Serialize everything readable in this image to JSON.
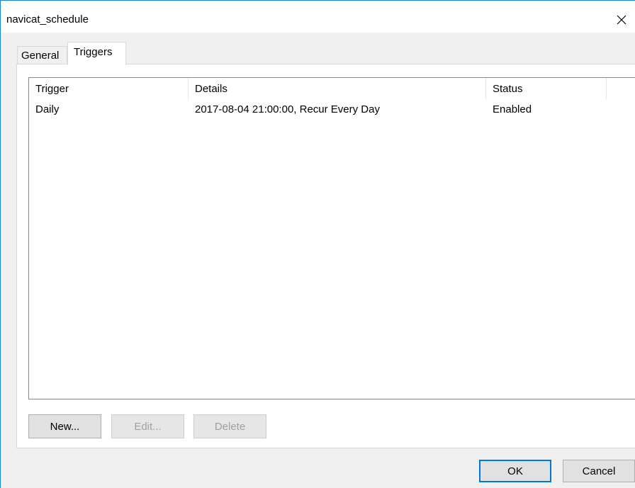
{
  "window": {
    "title": "navicat_schedule",
    "close_glyph": "close-icon"
  },
  "tabs": [
    {
      "label": "General"
    },
    {
      "label": "Triggers",
      "selected": true
    }
  ],
  "triggers_table": {
    "columns": [
      "Trigger",
      "Details",
      "Status"
    ],
    "rows": [
      {
        "trigger": "Daily",
        "details": "2017-08-04 21:00:00, Recur Every Day",
        "status": "Enabled"
      }
    ]
  },
  "panel_buttons": {
    "new": "New...",
    "edit": "Edit...",
    "delete": "Delete"
  },
  "dialog_buttons": {
    "ok": "OK",
    "cancel": "Cancel"
  },
  "colors": {
    "window_border": "#1883d7",
    "default_button_border": "#0078d7",
    "disabled_text": "#a0a0a0"
  }
}
